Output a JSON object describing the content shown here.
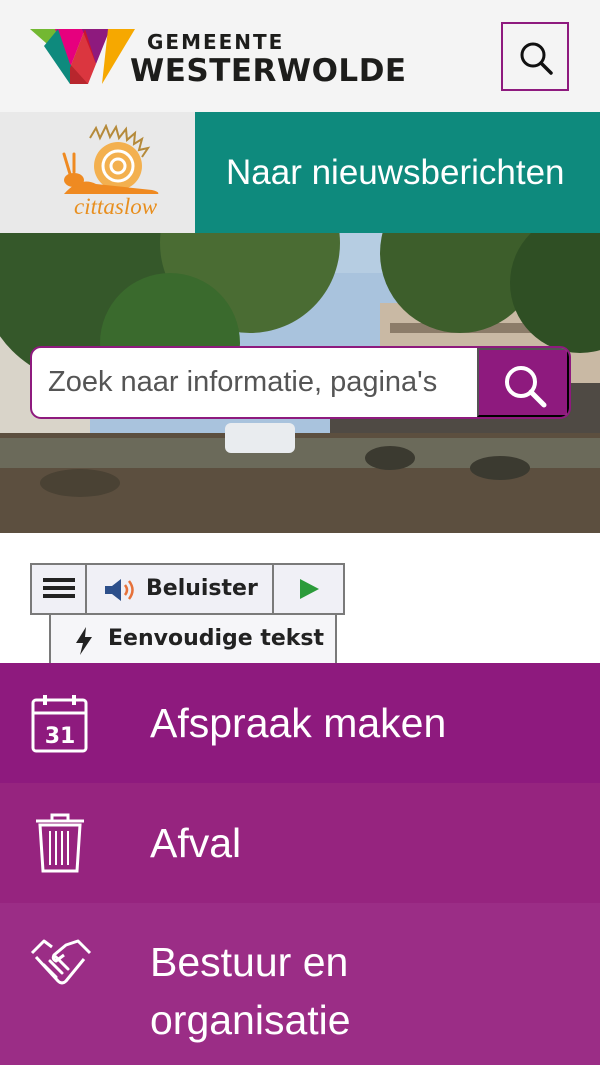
{
  "header": {
    "logo_small": "GEMEENTE",
    "logo_big": "WESTERWOLDE",
    "search_icon": "search-icon",
    "accent_color": "#8e1a7e"
  },
  "banner": {
    "partner_logo": "cittaslow",
    "news_link": "Naar nieuwsberichten",
    "news_color": "#0e8a7d"
  },
  "hero": {
    "search_placeholder": "Zoek naar informatie, pagina's",
    "search_button_icon": "search-icon"
  },
  "readspeaker": {
    "menu_icon": "hamburger-icon",
    "listen_label": "Beluister",
    "listen_icon": "speaker-icon",
    "play_icon": "play-icon",
    "simple_text_label": "Eenvoudige tekst",
    "simple_text_icon": "lightning-icon"
  },
  "tiles": [
    {
      "label": "Afspraak maken",
      "icon": "calendar-icon",
      "calendar_day": "31"
    },
    {
      "label": "Afval",
      "icon": "trash-icon"
    },
    {
      "label_line1": "Bestuur en",
      "label_line2": "organisatie",
      "icon": "handshake-icon"
    }
  ]
}
